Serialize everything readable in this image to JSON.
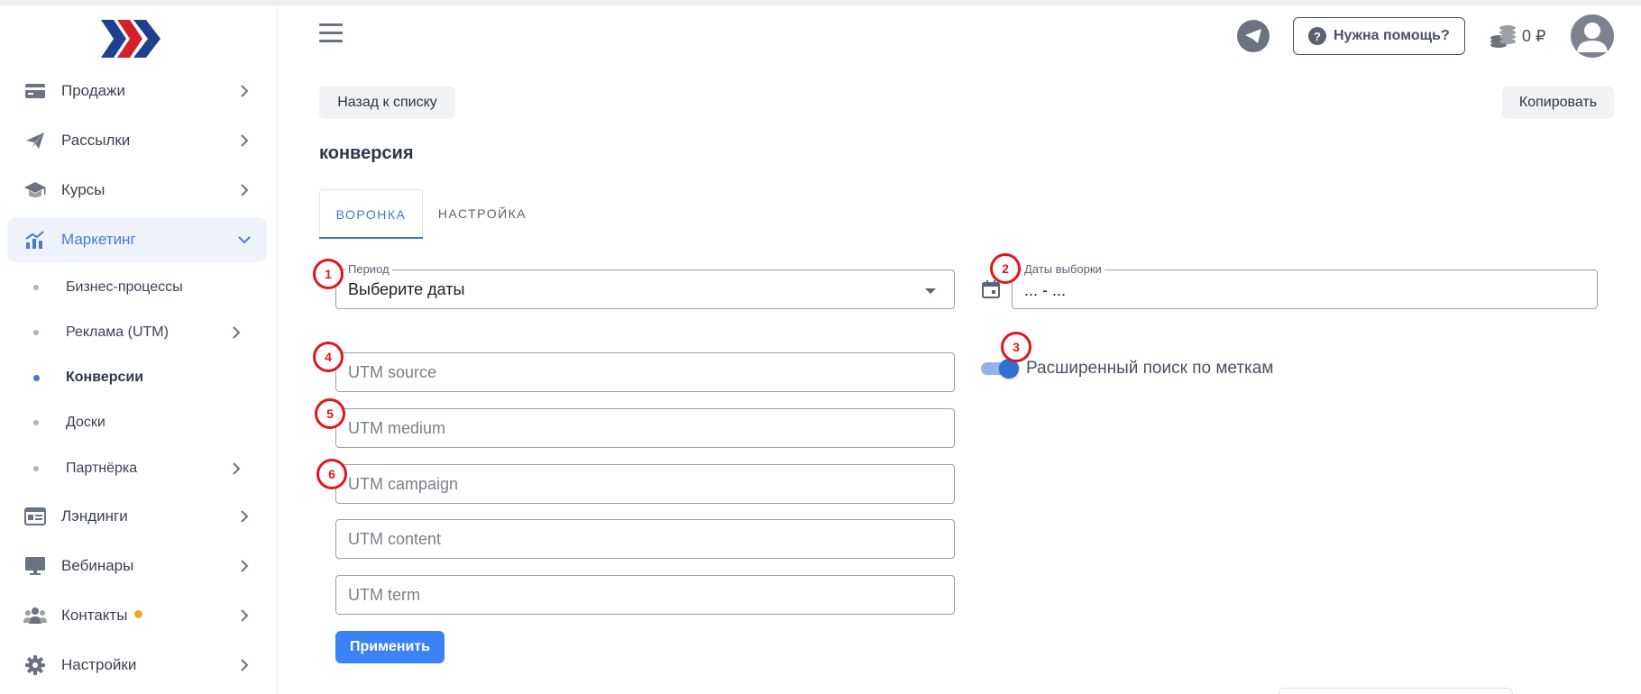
{
  "sidebar": {
    "items": [
      {
        "label": "Продажи",
        "icon": "card-icon"
      },
      {
        "label": "Рассылки",
        "icon": "paper-plane-icon"
      },
      {
        "label": "Курсы",
        "icon": "graduation-cap-icon"
      },
      {
        "label": "Маркетинг",
        "icon": "chart-icon",
        "active": true
      },
      {
        "label": "Лэндинги",
        "icon": "landing-page-icon"
      },
      {
        "label": "Вебинары",
        "icon": "monitor-icon"
      },
      {
        "label": "Контакты",
        "icon": "contacts-icon"
      },
      {
        "label": "Настройки",
        "icon": "gear-icon"
      }
    ],
    "subitems": [
      {
        "label": "Бизнес-процессы"
      },
      {
        "label": "Реклама (UTM)"
      },
      {
        "label": "Конверсии",
        "active": true
      },
      {
        "label": "Доски"
      },
      {
        "label": "Партнёрка"
      }
    ]
  },
  "header": {
    "help_label": "Нужна помощь?",
    "balance": "0 ₽"
  },
  "toolbar": {
    "back_label": "Назад к списку",
    "copy_label": "Копировать"
  },
  "page": {
    "title": "конверсия"
  },
  "tabs": [
    {
      "label": "ВОРОНКА",
      "active": true
    },
    {
      "label": "НАСТРОЙКА"
    }
  ],
  "filters": {
    "period_legend": "Период",
    "period_value": "Выберите даты",
    "dates_legend": "Даты выборки",
    "dates_value": "... - ...",
    "advanced_search_label": "Расширенный поиск по меткам",
    "advanced_search_on": true,
    "utm_source_placeholder": "UTM source",
    "utm_medium_placeholder": "UTM medium",
    "utm_campaign_placeholder": "UTM campaign",
    "utm_content_placeholder": "UTM content",
    "utm_term_placeholder": "UTM term",
    "apply_label": "Применить"
  },
  "markers": [
    "1",
    "2",
    "3",
    "4",
    "5",
    "6"
  ],
  "colors": {
    "accent": "#3b82f6",
    "active_nav": "#4b7bd1",
    "marker": "#e0161b"
  }
}
